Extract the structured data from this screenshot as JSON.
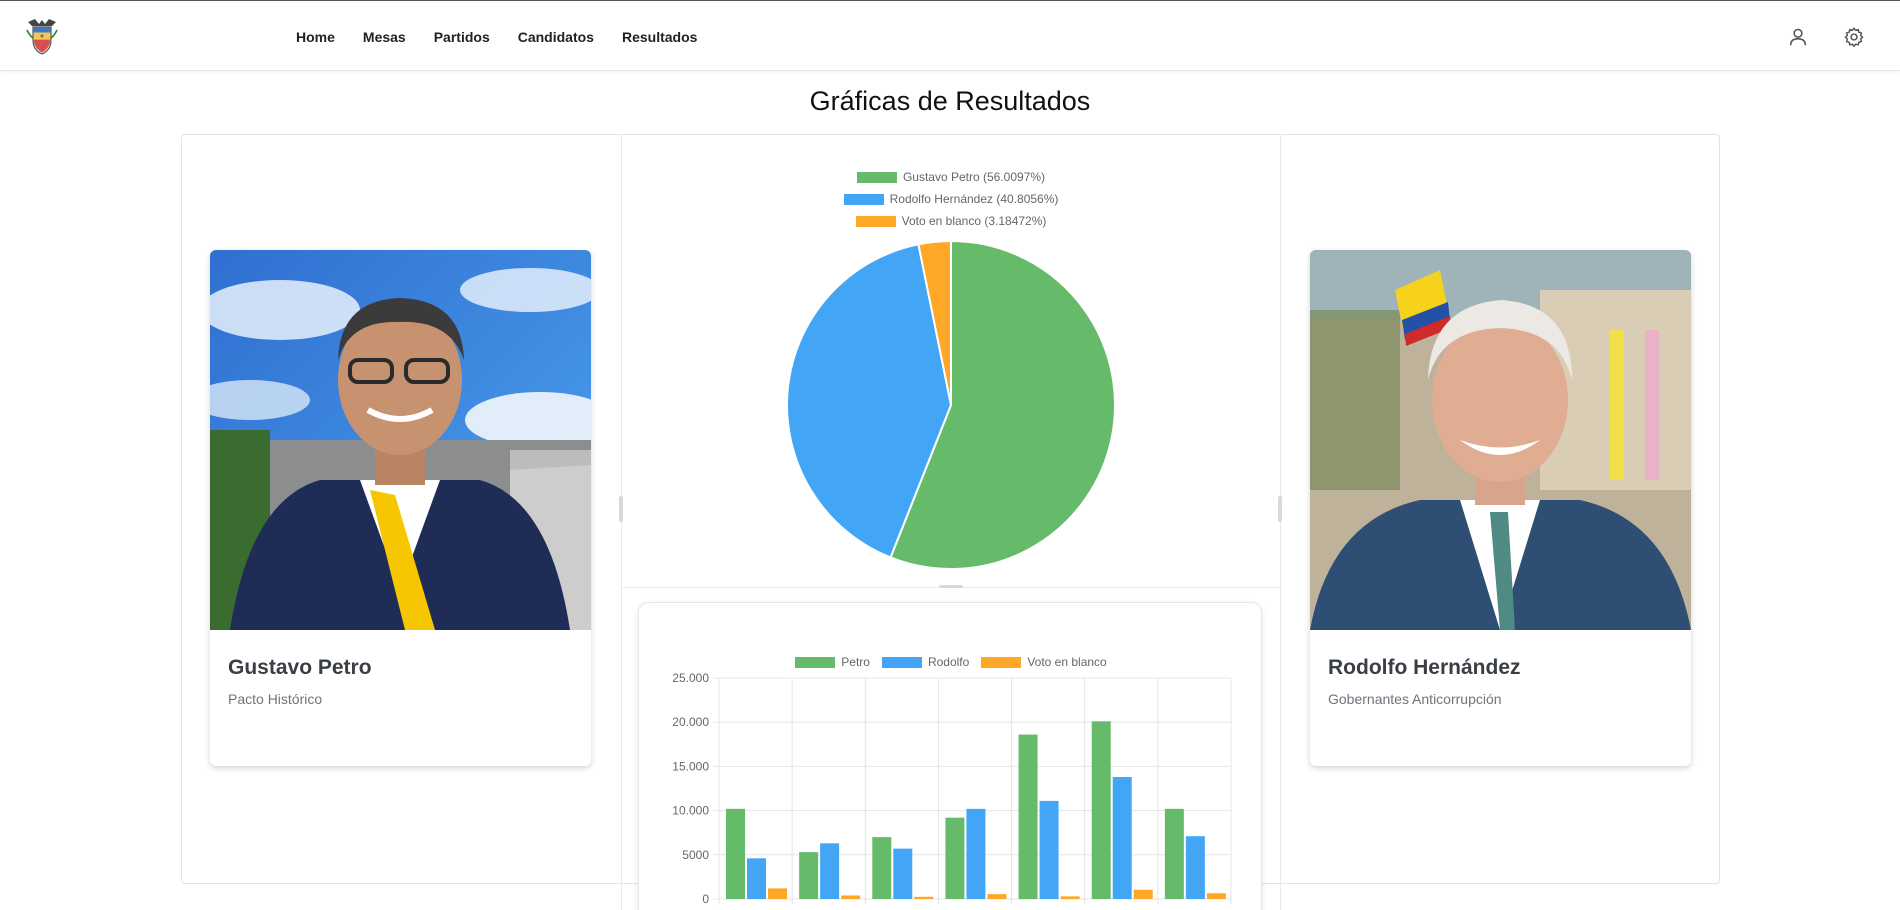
{
  "header": {
    "logo_icon": "colombia-coat-of-arms-icon",
    "nav": [
      {
        "label": "Home"
      },
      {
        "label": "Mesas"
      },
      {
        "label": "Partidos"
      },
      {
        "label": "Candidatos"
      },
      {
        "label": "Resultados"
      }
    ],
    "user_icon": "user-icon",
    "settings_icon": "gear-icon"
  },
  "page": {
    "title": "Gráficas de Resultados"
  },
  "candidates": [
    {
      "name": "Gustavo Petro",
      "party": "Pacto Histórico"
    },
    {
      "name": "Rodolfo Hernández",
      "party": "Gobernantes Anticorrupción"
    }
  ],
  "colors": {
    "petro": "#66bb6a",
    "rodolfo": "#42a5f5",
    "blanco": "#ffa726"
  },
  "chart_data": [
    {
      "type": "pie",
      "legend_position": "top",
      "labels": [
        "Gustavo Petro (56.0097%)",
        "Rodolfo Hernández (40.8056%)",
        "Voto en blanco (3.18472%)"
      ],
      "values": [
        56.0097,
        40.8056,
        3.18472
      ]
    },
    {
      "type": "bar",
      "legend_position": "top",
      "grid": true,
      "ylim": [
        0,
        25000
      ],
      "yticks": [
        "0",
        "5000",
        "10.000",
        "15.000",
        "20.000",
        "25.000"
      ],
      "categories": [
        "",
        "",
        "",
        "",
        "",
        "",
        ""
      ],
      "series": [
        {
          "name": "Petro",
          "values": [
            10200,
            5300,
            7000,
            9200,
            18600,
            20100,
            10200
          ]
        },
        {
          "name": "Rodolfo",
          "values": [
            4600,
            6300,
            5700,
            10200,
            11100,
            13800,
            7100
          ]
        },
        {
          "name": "Voto en blanco",
          "values": [
            1200,
            400,
            250,
            550,
            300,
            1050,
            650
          ]
        }
      ]
    }
  ]
}
